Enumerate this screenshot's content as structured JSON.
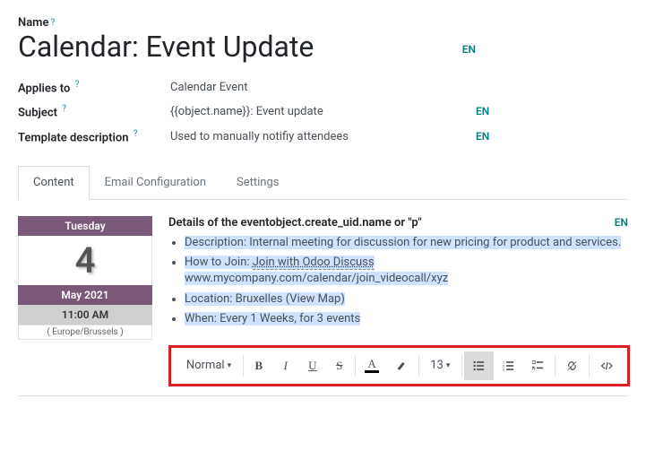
{
  "form": {
    "name_label": "Name",
    "name_value": "Calendar: Event Update",
    "applies_to_label": "Applies to",
    "applies_to_value": "Calendar Event",
    "subject_label": "Subject",
    "subject_value": "{{object.name}}: Event update",
    "template_desc_label": "Template description",
    "template_desc_value": "Used to manually notifiy attendees",
    "lang": "EN"
  },
  "tabs": {
    "content": "Content",
    "email_config": "Email Configuration",
    "settings": "Settings"
  },
  "calendar": {
    "weekday": "Tuesday",
    "day": "4",
    "month_year": "May 2021",
    "time": "11:00 AM",
    "timezone": "( Europe/Brussels )"
  },
  "details": {
    "heading": "Details of the eventobject.create_uid.name or \"p\"",
    "items": [
      "Description: Internal meeting for discussion for new pricing for product and services.",
      "How to Join: Join with Odoo Discuss www.mycompany.com/calendar/join_videocall/xyz",
      "Location: Bruxelles (View Map)",
      "When: Every 1 Weeks, for 3 events"
    ],
    "desc_prefix": "Description: ",
    "desc_text": "Internal meeting for discussion for new pricing for product and services.",
    "join_prefix": "How to Join: ",
    "join_link_text": "Join with Odoo Discuss",
    "join_url": "www.mycompany.com/calendar/join_videocall/xyz",
    "location": "Location: Bruxelles (View Map)",
    "when": "When: Every 1 Weeks, for 3 events"
  },
  "toolbar": {
    "style_label": "Normal",
    "font_size": "13"
  }
}
